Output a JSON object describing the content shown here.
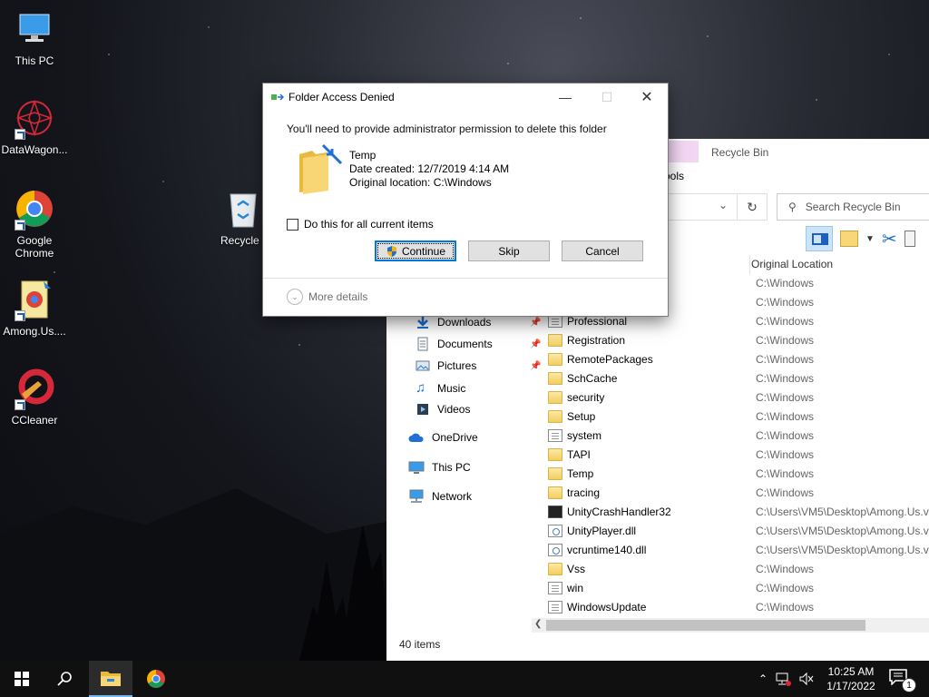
{
  "desktop": {
    "icons": [
      {
        "label": "This PC",
        "icon": "this-pc-icon"
      },
      {
        "label": "DataWagon...",
        "icon": "datawagon-icon"
      },
      {
        "label": "Google Chrome",
        "icon": "chrome-icon"
      },
      {
        "label": "Among.Us....",
        "icon": "among-us-icon"
      },
      {
        "label": "CCleaner",
        "icon": "ccleaner-icon"
      },
      {
        "label": "Recycle I",
        "icon": "recycle-bin-icon"
      }
    ]
  },
  "explorer": {
    "ribbon_title": "Recycle Bin",
    "tools_tab": "ools",
    "search_placeholder": "Search Recycle Bin",
    "column_original_location": "Original Location",
    "nav": [
      {
        "label": "Downloads",
        "icon": "downloads-icon",
        "pinned": true
      },
      {
        "label": "Documents",
        "icon": "documents-icon",
        "pinned": true
      },
      {
        "label": "Pictures",
        "icon": "pictures-icon",
        "pinned": true
      },
      {
        "label": "Music",
        "icon": "music-icon",
        "pinned": false
      },
      {
        "label": "Videos",
        "icon": "videos-icon",
        "pinned": false
      },
      {
        "label": "OneDrive",
        "icon": "onedrive-icon",
        "pinned": false
      },
      {
        "label": "This PC",
        "icon": "this-pc-icon",
        "pinned": false
      },
      {
        "label": "Network",
        "icon": "network-icon",
        "pinned": false
      }
    ],
    "files": [
      {
        "name": "",
        "location": "C:\\Windows",
        "type": "none"
      },
      {
        "name": "",
        "location": "C:\\Windows",
        "type": "none"
      },
      {
        "name": "Professional",
        "location": "C:\\Windows",
        "type": "file"
      },
      {
        "name": "Registration",
        "location": "C:\\Windows",
        "type": "folder"
      },
      {
        "name": "RemotePackages",
        "location": "C:\\Windows",
        "type": "folder"
      },
      {
        "name": "SchCache",
        "location": "C:\\Windows",
        "type": "folder"
      },
      {
        "name": "security",
        "location": "C:\\Windows",
        "type": "folder"
      },
      {
        "name": "Setup",
        "location": "C:\\Windows",
        "type": "folder"
      },
      {
        "name": "system",
        "location": "C:\\Windows",
        "type": "file"
      },
      {
        "name": "TAPI",
        "location": "C:\\Windows",
        "type": "folder"
      },
      {
        "name": "Temp",
        "location": "C:\\Windows",
        "type": "folder"
      },
      {
        "name": "tracing",
        "location": "C:\\Windows",
        "type": "folder"
      },
      {
        "name": "UnityCrashHandler32",
        "location": "C:\\Users\\VM5\\Desktop\\Among.Us.v",
        "type": "exe"
      },
      {
        "name": "UnityPlayer.dll",
        "location": "C:\\Users\\VM5\\Desktop\\Among.Us.v",
        "type": "dll"
      },
      {
        "name": "vcruntime140.dll",
        "location": "C:\\Users\\VM5\\Desktop\\Among.Us.v",
        "type": "dll"
      },
      {
        "name": "Vss",
        "location": "C:\\Windows",
        "type": "folder"
      },
      {
        "name": "win",
        "location": "C:\\Windows",
        "type": "file"
      },
      {
        "name": "WindowsUpdate",
        "location": "C:\\Windows",
        "type": "file"
      }
    ],
    "item_count": "40 items"
  },
  "dialog": {
    "title": "Folder Access Denied",
    "message": "You'll need to provide administrator permission to delete this folder",
    "item_name": "Temp",
    "date_created": "Date created: 12/7/2019 4:14 AM",
    "original_location": "Original location: C:\\Windows",
    "checkbox_label": "Do this for all current items",
    "continue_label": "Continue",
    "skip_label": "Skip",
    "cancel_label": "Cancel",
    "more_details": "More details"
  },
  "taskbar": {
    "time": "10:25 AM",
    "date": "1/17/2022",
    "notification_count": "1"
  },
  "colors": {
    "accent": "#0078d7",
    "folder": "#f3ce5e",
    "taskbar": "#101010"
  }
}
